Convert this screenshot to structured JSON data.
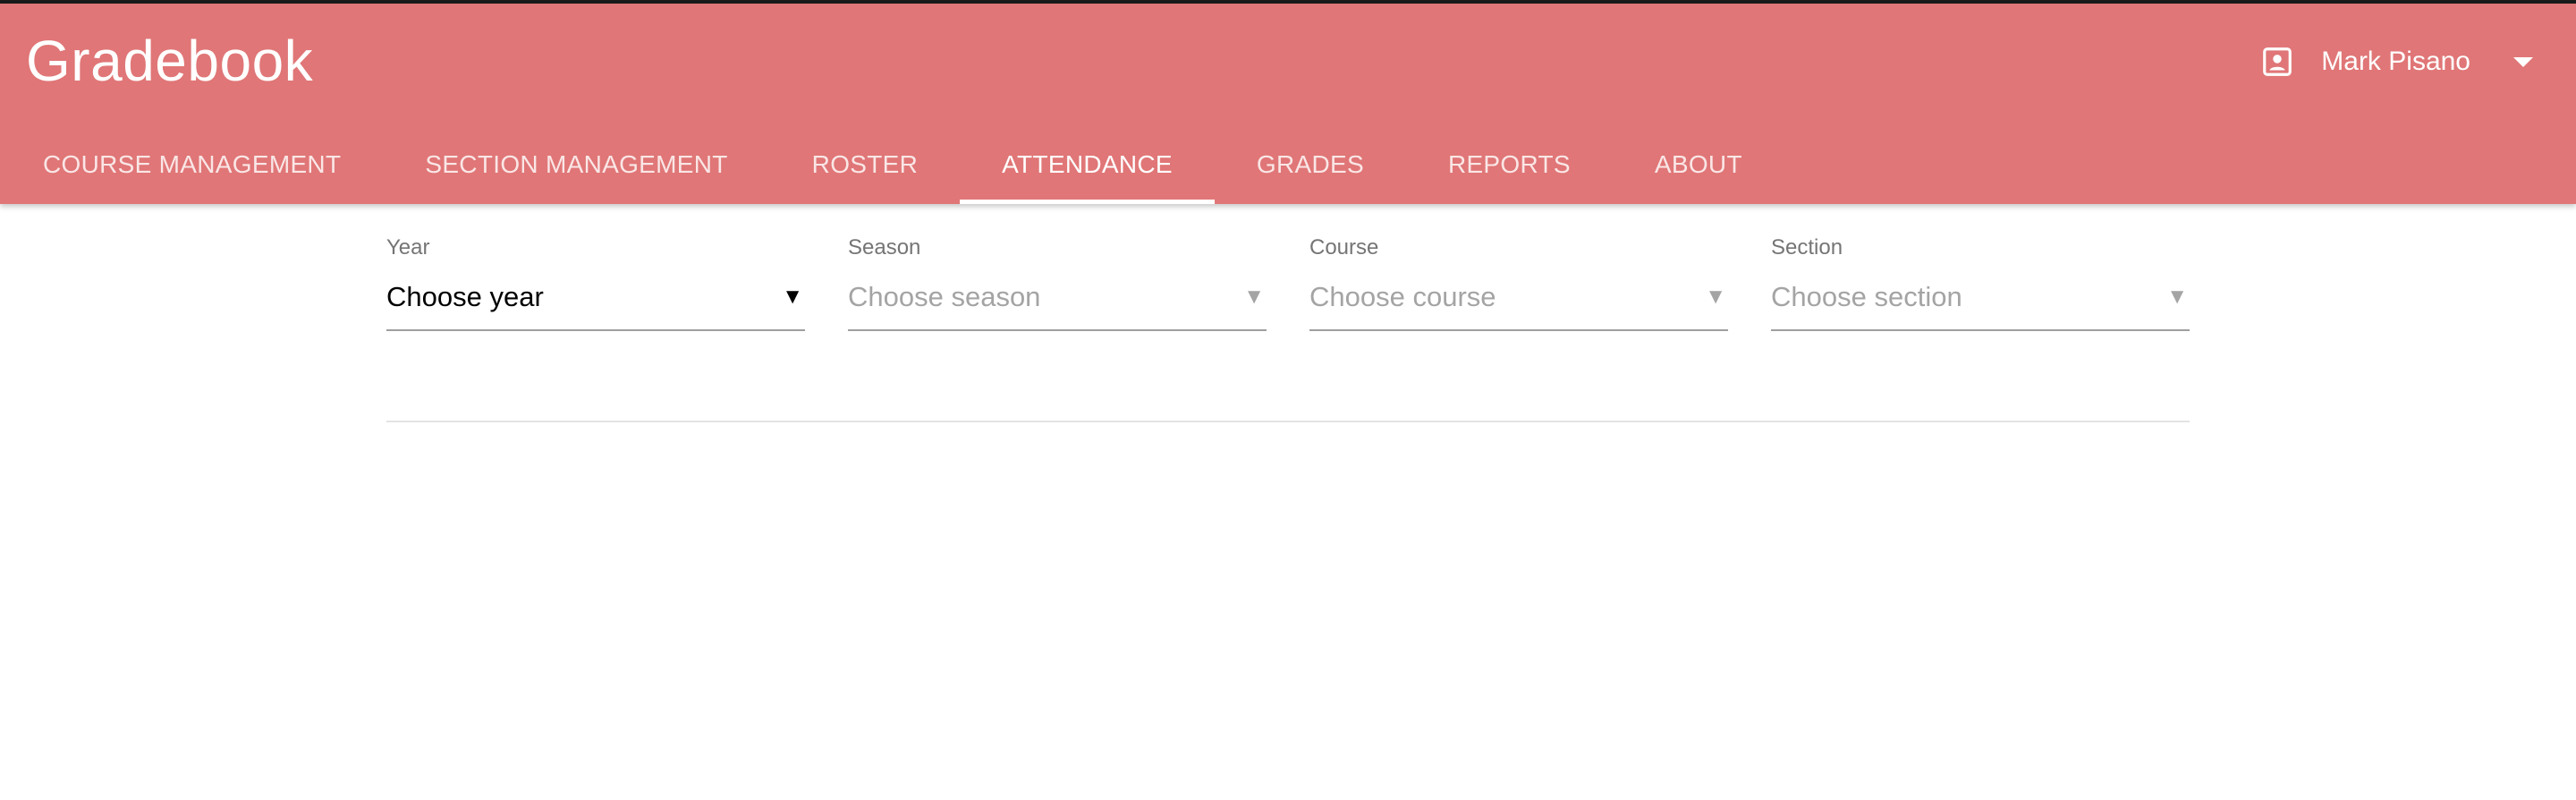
{
  "app": {
    "title": "Gradebook"
  },
  "user": {
    "name": "Mark Pisano",
    "icon": "account-box-icon"
  },
  "tabs": [
    {
      "label": "COURSE MANAGEMENT",
      "active": false
    },
    {
      "label": "SECTION MANAGEMENT",
      "active": false
    },
    {
      "label": "ROSTER",
      "active": false
    },
    {
      "label": "ATTENDANCE",
      "active": true
    },
    {
      "label": "GRADES",
      "active": false
    },
    {
      "label": "REPORTS",
      "active": false
    },
    {
      "label": "ABOUT",
      "active": false
    }
  ],
  "filters": {
    "year": {
      "label": "Year",
      "value": "Choose year"
    },
    "season": {
      "label": "Season",
      "value": "Choose season"
    },
    "course": {
      "label": "Course",
      "value": "Choose course"
    },
    "section": {
      "label": "Section",
      "value": "Choose section"
    }
  },
  "colors": {
    "appbar": "#e07677",
    "text_on_appbar": "#ffffff",
    "placeholder": "#a4a4a4"
  }
}
